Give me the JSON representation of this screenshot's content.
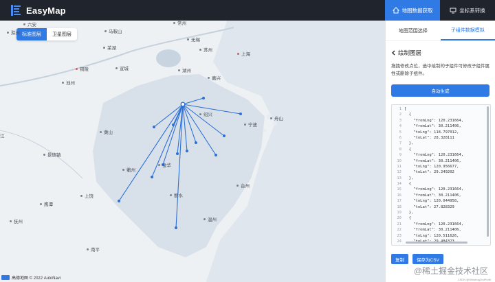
{
  "app": {
    "title": "EasyMap"
  },
  "top_tabs": [
    {
      "label": "地图数据获取",
      "active": true
    },
    {
      "label": "坐标系转换",
      "active": false
    }
  ],
  "layer_toggle": {
    "standard": "标准图层",
    "satellite": "卫星图层"
  },
  "cities": [
    {
      "name": "六安",
      "dot": "gray"
    },
    {
      "name": "滁州",
      "dot": "gray"
    },
    {
      "name": "马鞍山",
      "dot": "gray"
    },
    {
      "name": "常州",
      "dot": "gray"
    },
    {
      "name": "无锡",
      "dot": "gray"
    },
    {
      "name": "苏州",
      "dot": "gray"
    },
    {
      "name": "芜湖",
      "dot": "gray"
    },
    {
      "name": "上海",
      "dot": "red"
    },
    {
      "name": "铜陵",
      "dot": "red"
    },
    {
      "name": "宣城",
      "dot": "gray"
    },
    {
      "name": "湖州",
      "dot": "gray"
    },
    {
      "name": "池州",
      "dot": "gray"
    },
    {
      "name": "嘉兴",
      "dot": "gray"
    },
    {
      "name": "绍兴",
      "dot": "gray"
    },
    {
      "name": "宁波",
      "dot": "gray"
    },
    {
      "name": "舟山",
      "dot": "gray"
    },
    {
      "name": "黄山",
      "dot": "gray"
    },
    {
      "name": "景德镇",
      "dot": "gray"
    },
    {
      "name": "衢州",
      "dot": "gray"
    },
    {
      "name": "金华",
      "dot": "gray"
    },
    {
      "name": "上饶",
      "dot": "gray"
    },
    {
      "name": "丽水",
      "dot": "gray"
    },
    {
      "name": "台州",
      "dot": "gray"
    },
    {
      "name": "鹰潭",
      "dot": "gray"
    },
    {
      "name": "抚州",
      "dot": "gray"
    },
    {
      "name": "温州",
      "dot": "gray"
    },
    {
      "name": "南平",
      "dot": "gray"
    },
    {
      "name": "江",
      "dot": "none"
    }
  ],
  "map_footer": "高德地图 © 2022 AutoNavi",
  "panel": {
    "sub_tabs": [
      {
        "label": "地图范围选择",
        "active": false
      },
      {
        "label": "子组件数据模拟",
        "active": true
      }
    ],
    "section_title": "绘制图层",
    "description": "拖拽修改点位，选中绘制的子组件可修改子组件属性或删除子组件。",
    "generate_button": "自动生成",
    "code_lines": [
      "[",
      "  {",
      "    \"fromLng\": 120.231664,",
      "    \"fromLat\": 30.211406,",
      "    \"toLng\": 118.797012,",
      "    \"toLat\": 28.328111",
      "  },",
      "  {",
      "    \"fromLng\": 120.231664,",
      "    \"fromLat\": 30.211406,",
      "    \"toLng\": 120.956677,",
      "    \"toLat\": 29.249202",
      "  },",
      "  {",
      "    \"fromLng\": 120.231664,",
      "    \"fromLat\": 30.211406,",
      "    \"toLng\": 120.044958,",
      "    \"toLat\": 27.828329",
      "  },",
      "  {",
      "    \"fromLng\": 120.231664,",
      "    \"fromLat\": 30.211406,",
      "    \"toLng\": 120.511626,",
      "    \"toLat\": 29.484323",
      "  },"
    ],
    "copy_button": "复制",
    "save_button": "保存为CSV",
    "watermark": "@稀土掘金技术社区",
    "credit": "CSDN @Winsfrog2ndProfit"
  },
  "colors": {
    "accent": "#2f7ae5",
    "topbar": "#20242c",
    "line": "#2b6fd6"
  }
}
